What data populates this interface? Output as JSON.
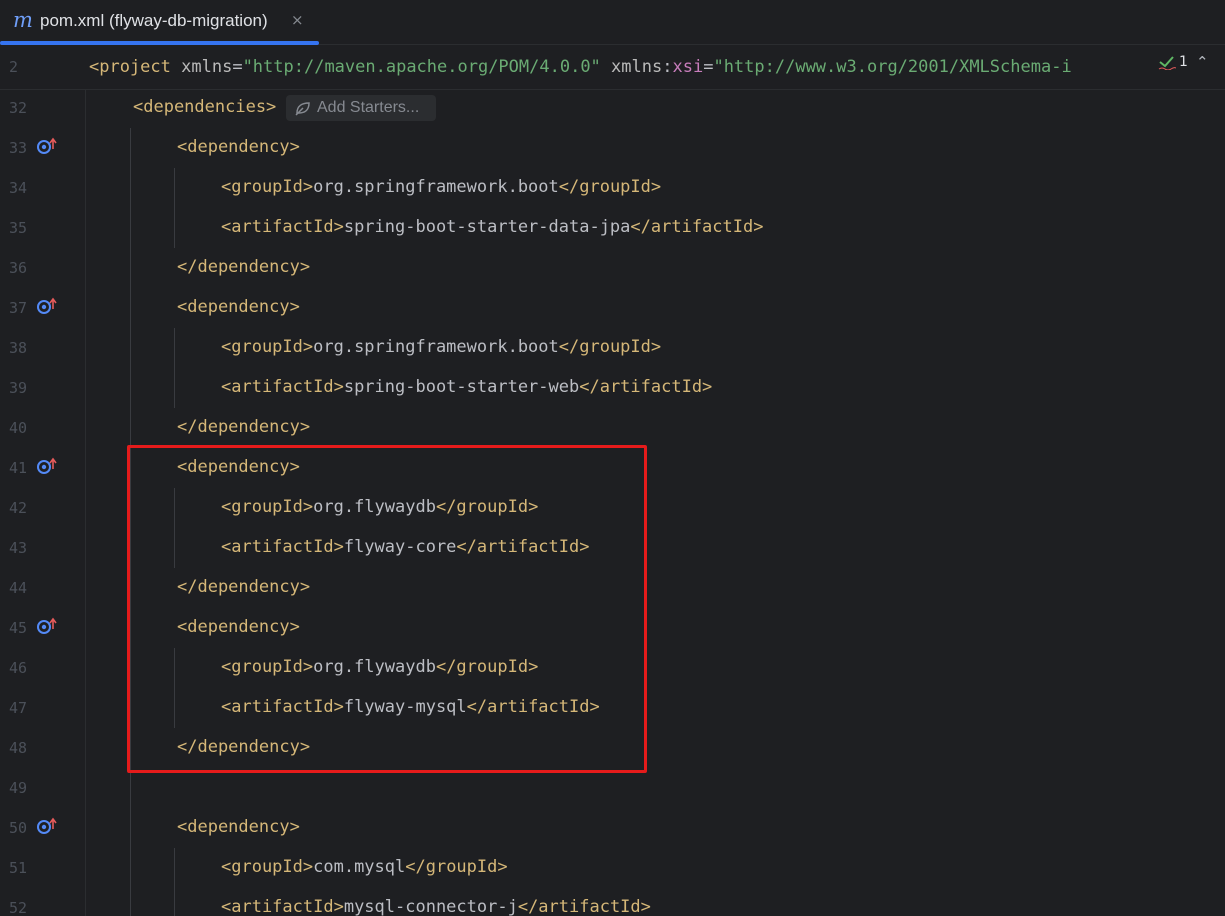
{
  "tab": {
    "icon": "m",
    "label": "pom.xml (flyway-db-migration)",
    "close": "×"
  },
  "sticky": {
    "line_number": "2",
    "open": "<project ",
    "attr1": "xmlns",
    "eq1": "=",
    "val1": "\"http://maven.apache.org/POM/4.0.0\"",
    "space": " ",
    "attr2_prefix": "xmlns",
    "colon": ":",
    "attr2_ns": "xsi",
    "eq2": "=",
    "val2": "\"http://www.w3.org/2001/XMLSchema-i"
  },
  "inspections": {
    "count": "1",
    "icon": "check-icon"
  },
  "hint": {
    "label": "Add Starters..."
  },
  "lines": {
    "l32": {
      "num": "32",
      "tag": "<dependencies>"
    },
    "l33": {
      "num": "33",
      "tag": "<dependency>"
    },
    "l34": {
      "num": "34",
      "open": "<groupId>",
      "text": "org.springframework.boot",
      "close": "</groupId>"
    },
    "l35": {
      "num": "35",
      "open": "<artifactId>",
      "text": "spring-boot-starter-data-jpa",
      "close": "</artifactId>"
    },
    "l36": {
      "num": "36",
      "tag": "</dependency>"
    },
    "l37": {
      "num": "37",
      "tag": "<dependency>"
    },
    "l38": {
      "num": "38",
      "open": "<groupId>",
      "text": "org.springframework.boot",
      "close": "</groupId>"
    },
    "l39": {
      "num": "39",
      "open": "<artifactId>",
      "text": "spring-boot-starter-web",
      "close": "</artifactId>"
    },
    "l40": {
      "num": "40",
      "tag": "</dependency>"
    },
    "l41": {
      "num": "41",
      "tag": "<dependency>"
    },
    "l42": {
      "num": "42",
      "open": "<groupId>",
      "text": "org.flywaydb",
      "close": "</groupId>"
    },
    "l43": {
      "num": "43",
      "open": "<artifactId>",
      "text": "flyway-core",
      "close": "</artifactId>"
    },
    "l44": {
      "num": "44",
      "tag": "</dependency>"
    },
    "l45": {
      "num": "45",
      "tag": "<dependency>"
    },
    "l46": {
      "num": "46",
      "open": "<groupId>",
      "text": "org.flywaydb",
      "close": "</groupId>"
    },
    "l47": {
      "num": "47",
      "open": "<artifactId>",
      "text": "flyway-mysql",
      "close": "</artifactId>"
    },
    "l48": {
      "num": "48",
      "tag": "</dependency>"
    },
    "l49": {
      "num": "49"
    },
    "l50": {
      "num": "50",
      "tag": "<dependency>"
    },
    "l51": {
      "num": "51",
      "open": "<groupId>",
      "text": "com.mysql",
      "close": "</groupId>"
    },
    "l52": {
      "num": "52",
      "open": "<artifactId>",
      "text": "mysql-connector-j",
      "close": "</artifactId>"
    }
  },
  "colors": {
    "background": "#1e1f22",
    "tag": "#d5b778",
    "text": "#bcbec4",
    "string": "#6aab73",
    "namespace": "#c77dbb",
    "accent": "#3574f0",
    "highlight_box": "#e51b1b"
  }
}
